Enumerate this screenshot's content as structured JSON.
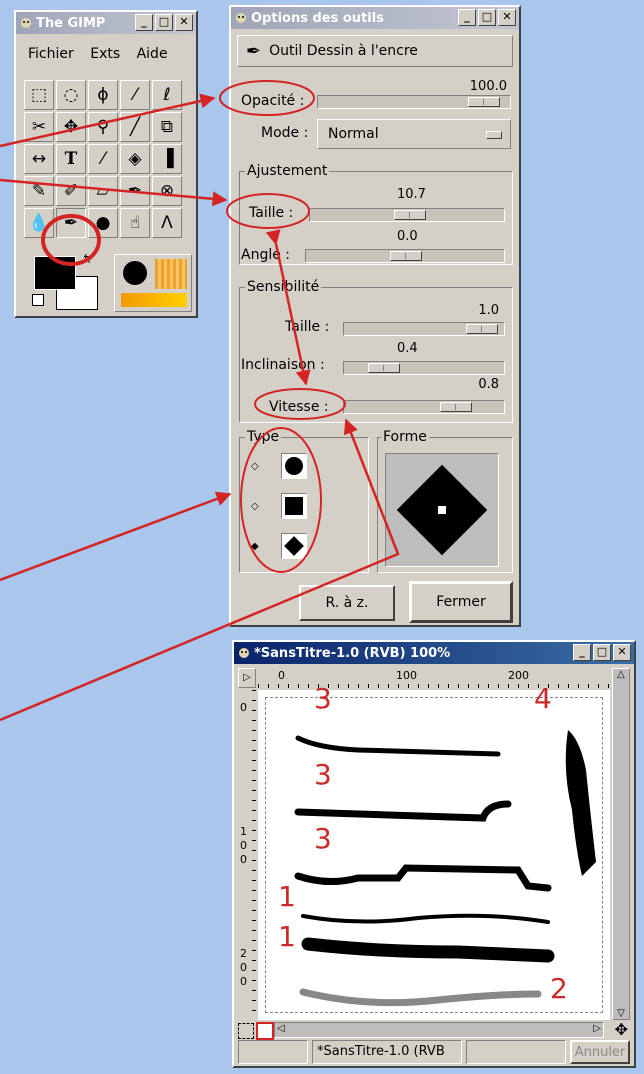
{
  "gimp": {
    "title": "The GIMP",
    "menu": [
      "Fichier",
      "Exts",
      "Aide"
    ]
  },
  "options": {
    "title": "Options des outils",
    "tool_name": "Outil Dessin à l'encre",
    "opacity_label": "Opacité :",
    "opacity_value": "100.0",
    "mode_label": "Mode :",
    "mode_value": "Normal",
    "adjust_title": "Ajustement",
    "size_label": "Taille :",
    "size_value": "10.7",
    "angle_label": "Angle :",
    "angle_value": "0.0",
    "sens_title": "Sensibilité",
    "sens_size_label": "Taille :",
    "sens_size_value": "1.0",
    "tilt_label": "Inclinaison :",
    "tilt_value": "0.4",
    "speed_label": "Vitesse :",
    "speed_value": "0.8",
    "type_title": "Type",
    "shape_title": "Forme",
    "reset_label": "R. à z.",
    "close_label": "Fermer"
  },
  "image_window": {
    "title": "*SansTitre-1.0 (RVB) 100%",
    "ruler_top": [
      "0",
      "100",
      "200"
    ],
    "ruler_left": [
      "0",
      "1",
      "0",
      "0",
      "2",
      "0",
      "0"
    ],
    "status_text": "*SansTitre-1.0 (RVB",
    "cancel_label": "Annuler"
  },
  "annotations": {
    "stroke_labels": [
      "3",
      "3",
      "3",
      "1",
      "1",
      "2",
      "4"
    ]
  }
}
